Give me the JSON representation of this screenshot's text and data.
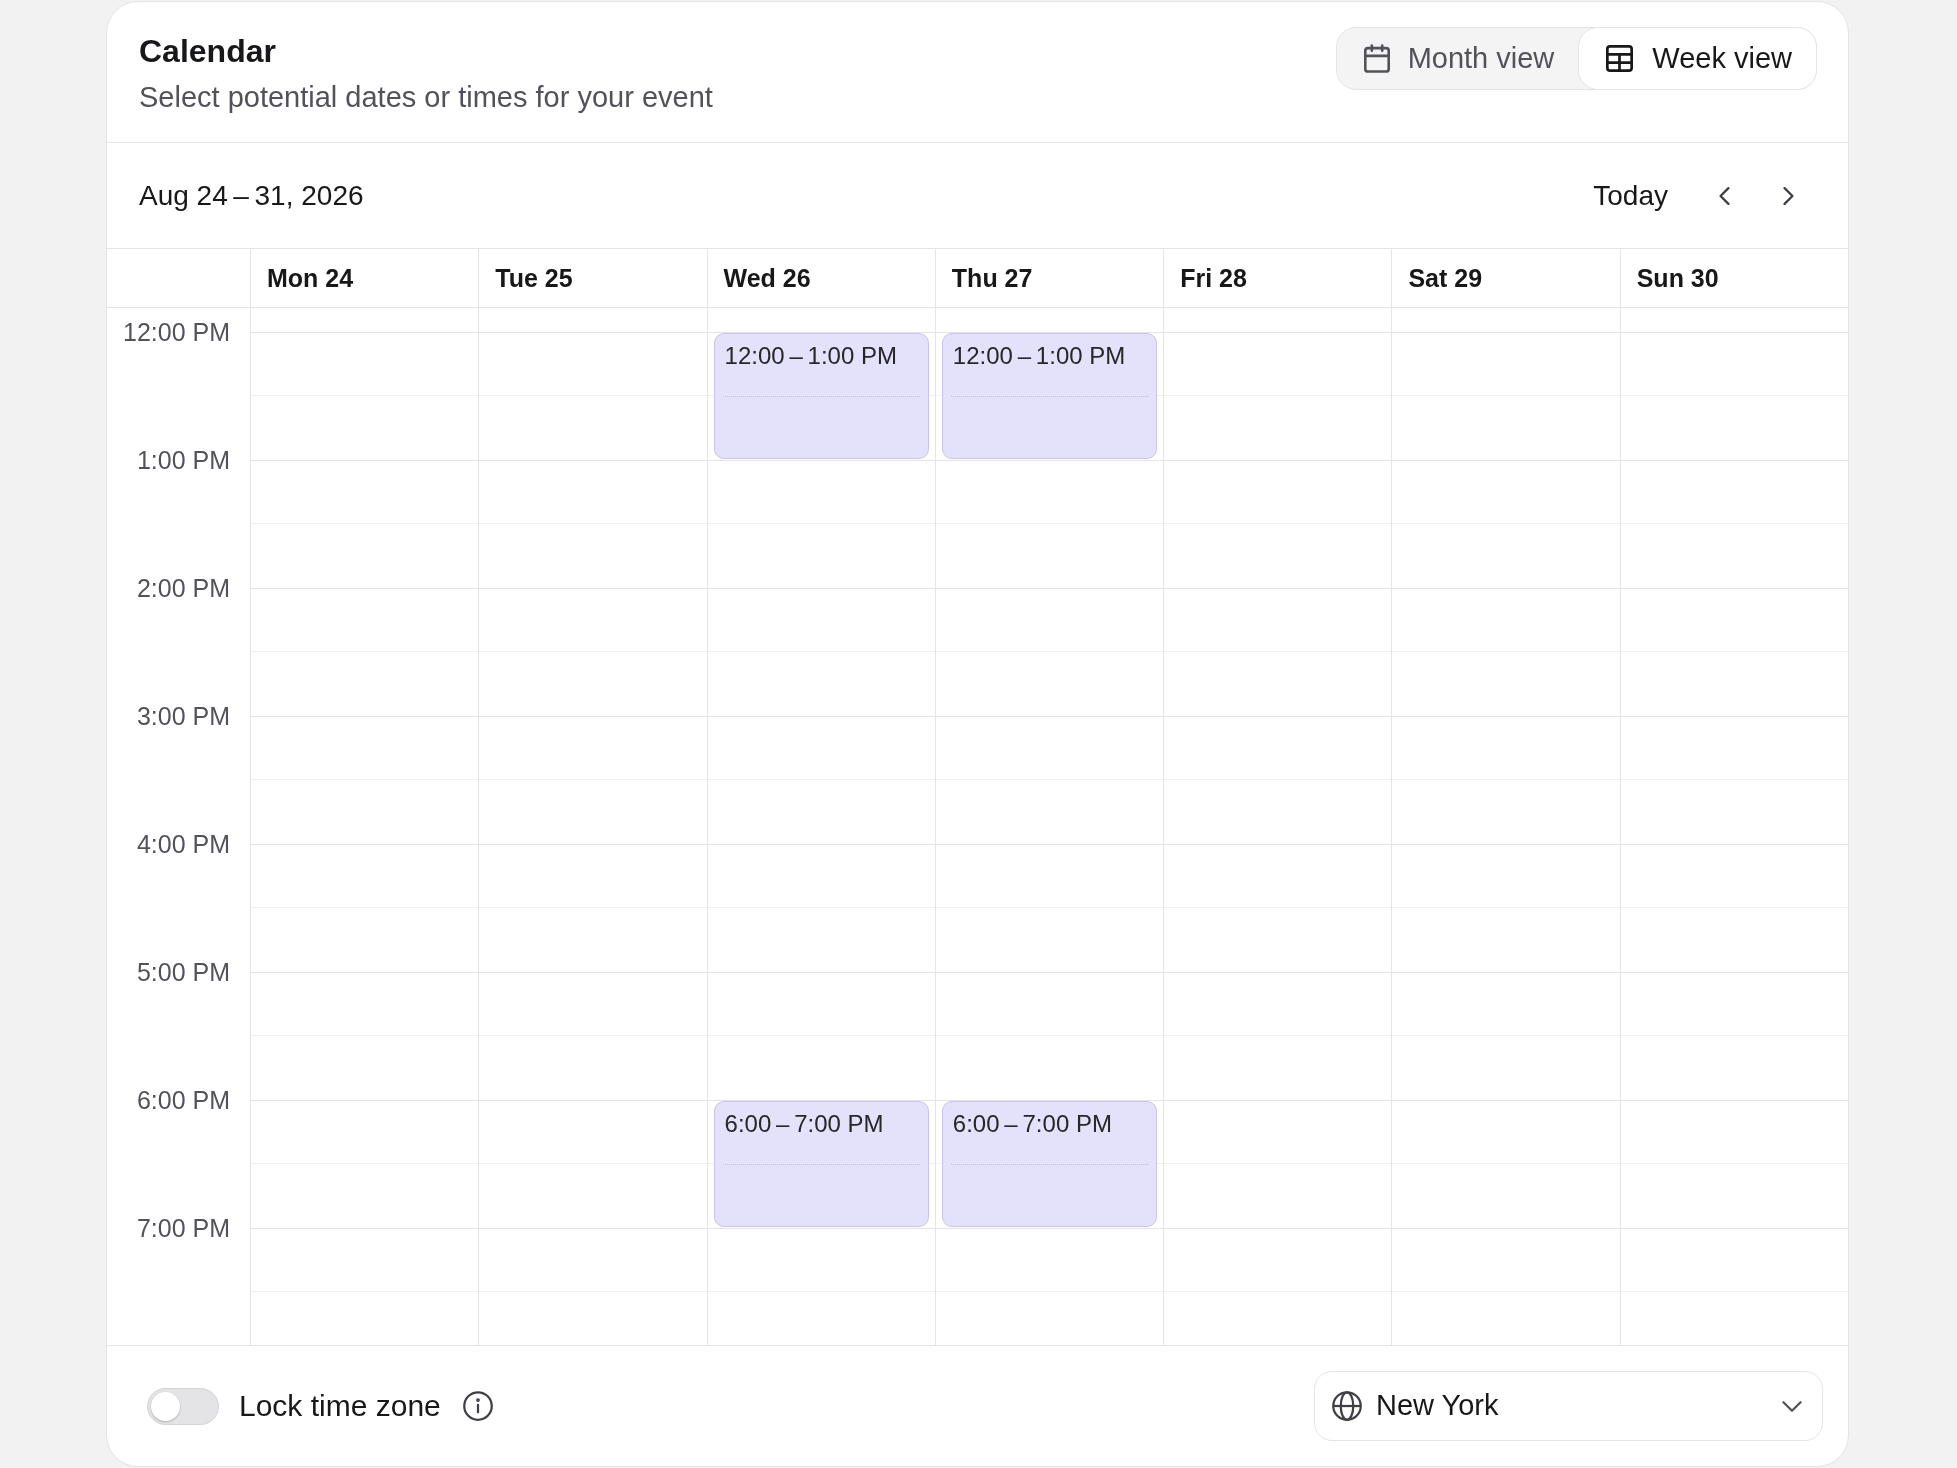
{
  "header": {
    "title": "Calendar",
    "subtitle": "Select potential dates or times for your event",
    "views": [
      {
        "kind": "month",
        "label": "Month view",
        "selected": false
      },
      {
        "kind": "week",
        "label": "Week view",
        "selected": true
      }
    ]
  },
  "toolbar": {
    "range": "Aug 24 – 31, 2026",
    "today": "Today"
  },
  "grid": {
    "times": [
      "12:00 PM",
      "1:00 PM",
      "2:00 PM",
      "3:00 PM",
      "4:00 PM",
      "5:00 PM",
      "6:00 PM",
      "7:00 PM"
    ],
    "days": [
      {
        "label": "Mon 24",
        "slots": [
          {
            "selected": false
          },
          {
            "selected": false
          },
          {
            "selected": false
          },
          {
            "selected": false
          },
          {
            "selected": false
          },
          {
            "selected": false
          },
          {
            "selected": false
          },
          {
            "selected": false
          }
        ]
      },
      {
        "label": "Tue 25",
        "slots": [
          {
            "selected": false
          },
          {
            "selected": false
          },
          {
            "selected": false
          },
          {
            "selected": false
          },
          {
            "selected": false
          },
          {
            "selected": false
          },
          {
            "selected": false
          },
          {
            "selected": false
          }
        ]
      },
      {
        "label": "Wed 26",
        "slots": [
          {
            "selected": true,
            "label": "12:00 – 1:00 PM"
          },
          {
            "selected": false
          },
          {
            "selected": false
          },
          {
            "selected": false
          },
          {
            "selected": false
          },
          {
            "selected": false
          },
          {
            "selected": true,
            "label": "6:00 – 7:00 PM"
          },
          {
            "selected": false
          }
        ]
      },
      {
        "label": "Thu 27",
        "slots": [
          {
            "selected": true,
            "label": "12:00 – 1:00 PM"
          },
          {
            "selected": false
          },
          {
            "selected": false
          },
          {
            "selected": false
          },
          {
            "selected": false
          },
          {
            "selected": false
          },
          {
            "selected": true,
            "label": "6:00 – 7:00 PM"
          },
          {
            "selected": false
          }
        ]
      },
      {
        "label": "Fri 28",
        "slots": [
          {
            "selected": false
          },
          {
            "selected": false
          },
          {
            "selected": false
          },
          {
            "selected": false
          },
          {
            "selected": false
          },
          {
            "selected": false
          },
          {
            "selected": false
          },
          {
            "selected": false
          }
        ]
      },
      {
        "label": "Sat 29",
        "slots": [
          {
            "selected": false
          },
          {
            "selected": false
          },
          {
            "selected": false
          },
          {
            "selected": false
          },
          {
            "selected": false
          },
          {
            "selected": false
          },
          {
            "selected": false
          },
          {
            "selected": false
          }
        ]
      },
      {
        "label": "Sun 30",
        "slots": [
          {
            "selected": false
          },
          {
            "selected": false
          },
          {
            "selected": false
          },
          {
            "selected": false
          },
          {
            "selected": false
          },
          {
            "selected": false
          },
          {
            "selected": false
          },
          {
            "selected": false
          }
        ]
      }
    ]
  },
  "footer": {
    "lock_time_zone": {
      "label": "Lock time zone",
      "on": false
    },
    "time_zone": {
      "value": "New York"
    }
  }
}
